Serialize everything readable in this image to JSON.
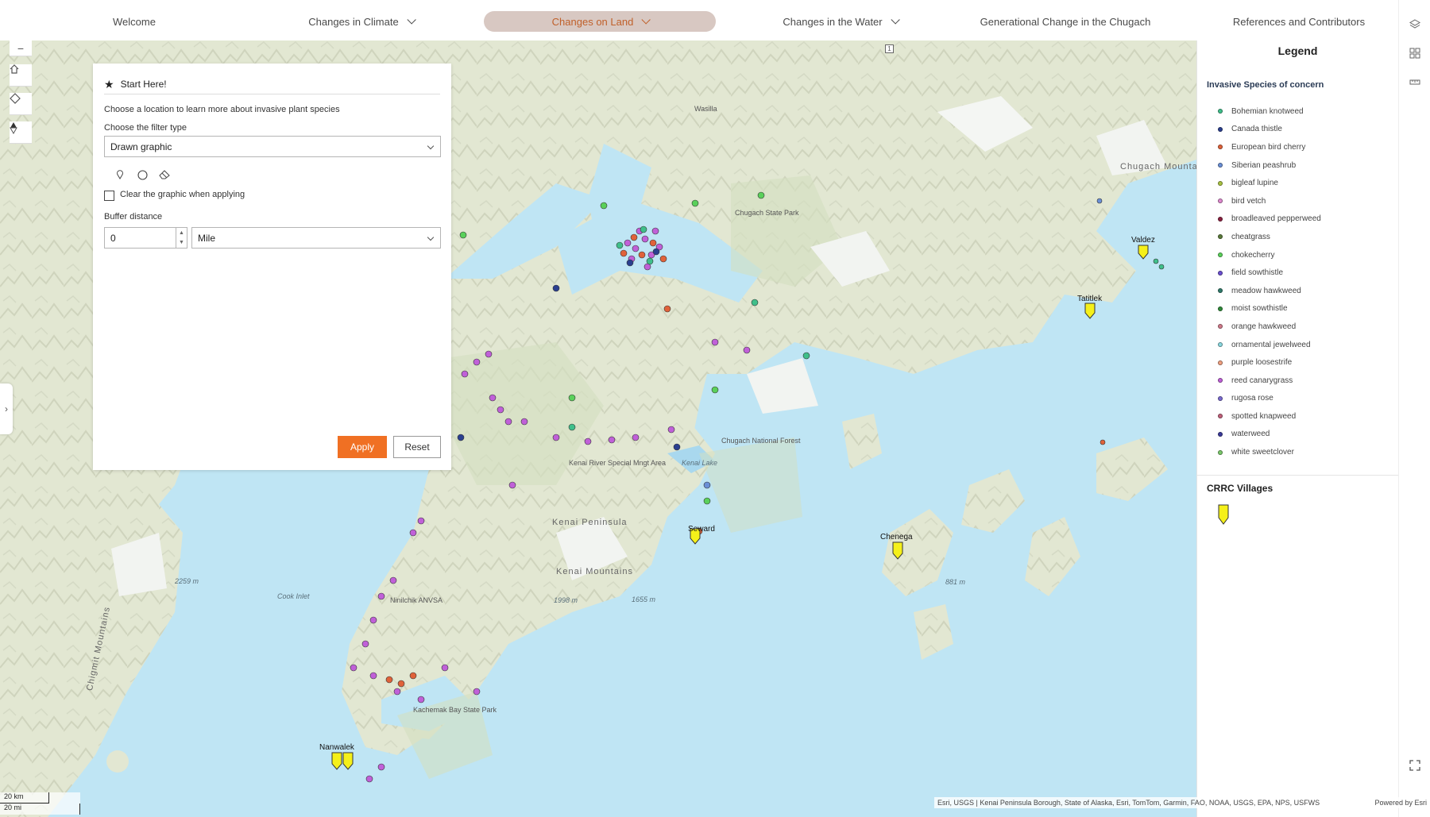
{
  "nav": {
    "items": [
      {
        "label": "Welcome",
        "dropdown": false
      },
      {
        "label": "Changes in Climate",
        "dropdown": true
      },
      {
        "label": "Changes on Land",
        "dropdown": true,
        "active": true
      },
      {
        "label": "Changes in the Water",
        "dropdown": true
      },
      {
        "label": "Generational Change in the Chugach",
        "dropdown": false
      },
      {
        "label": "References and Contributors",
        "dropdown": false
      }
    ]
  },
  "panel": {
    "title": "Start Here!",
    "intro": "Choose a location to learn more about invasive plant species",
    "filter_label": "Choose the filter type",
    "filter_value": "Drawn graphic",
    "clear_label": "Clear the graphic when applying",
    "clear_checked": false,
    "buffer_label": "Buffer distance",
    "buffer_value": "0",
    "buffer_unit": "Mile",
    "apply_label": "Apply",
    "reset_label": "Reset"
  },
  "legend": {
    "title": "Legend",
    "species_title": "Invasive Species of concern",
    "species": [
      {
        "name": "Bohemian knotweed",
        "color": "#3fbf8a"
      },
      {
        "name": "Canada thistle",
        "color": "#2a3f8f"
      },
      {
        "name": "European bird cherry",
        "color": "#e0623a"
      },
      {
        "name": "Siberian peashrub",
        "color": "#6a8fd6"
      },
      {
        "name": "bigleaf lupine",
        "color": "#a8c240"
      },
      {
        "name": "bird vetch",
        "color": "#e08ad0"
      },
      {
        "name": "broadleaved pepperweed",
        "color": "#8b2040"
      },
      {
        "name": "cheatgrass",
        "color": "#5a7a3a"
      },
      {
        "name": "chokecherry",
        "color": "#5ad05a"
      },
      {
        "name": "field sowthistle",
        "color": "#6a4fd0"
      },
      {
        "name": "meadow hawkweed",
        "color": "#2f7a6a"
      },
      {
        "name": "moist sowthistle",
        "color": "#2f8a3a"
      },
      {
        "name": "orange hawkweed",
        "color": "#d07a8a"
      },
      {
        "name": "ornamental jewelweed",
        "color": "#8ad8e0"
      },
      {
        "name": "purple loosestrife",
        "color": "#f0a080"
      },
      {
        "name": "reed canarygrass",
        "color": "#c060d8"
      },
      {
        "name": "rugosa rose",
        "color": "#7a6ad0"
      },
      {
        "name": "spotted knapweed",
        "color": "#c0607a"
      },
      {
        "name": "waterweed",
        "color": "#3a3a9a"
      },
      {
        "name": "white sweetclover",
        "color": "#7ac86a"
      }
    ],
    "villages_title": "CRRC Villages",
    "village_symbol_color": "#f5f01a"
  },
  "map": {
    "place_labels": {
      "wasilla": "Wasilla",
      "chugach_mountains": "Chugach Mountains",
      "chugach_state_park": "Chugach State Park",
      "chugach_national_forest": "Chugach National Forest",
      "kenai_river": "Kenai River Special Mngt Area",
      "kenai_lake": "Kenai Lake",
      "kenai_peninsula": "Kenai Peninsula",
      "kenai_mountains": "Kenai Mountains",
      "cook_inlet": "Cook Inlet",
      "ninilchik": "Ninilchik ANVSA",
      "kachemak": "Kachemak Bay State Park",
      "chigmit": "Chigmit Mountains",
      "elev_2259": "2259 m",
      "elev_1998": "1998 m",
      "elev_1655": "1655 m",
      "elev_881": "881 m"
    },
    "villages": {
      "valdez": "Valdez",
      "tatitlek": "Tatitlek",
      "seward": "Seward",
      "chenega": "Chenega",
      "nanwalek": "Nanwalek"
    },
    "scale_km": "20 km",
    "scale_mi": "20 mi",
    "attribution": "Esri, USGS | Kenai Peninsula Borough, State of Alaska, Esri, TomTom, Garmin, FAO, NOAA, USGS, EPA, NPS, USFWS",
    "powered_by": "Powered by Esri",
    "tile_marker": "1"
  },
  "colors": {
    "accent": "#f07023",
    "active_tab_bg": "#d8c8c2",
    "active_tab_text": "#c0602a",
    "water": "#bfe5f4",
    "land": "#e3e8d3"
  }
}
